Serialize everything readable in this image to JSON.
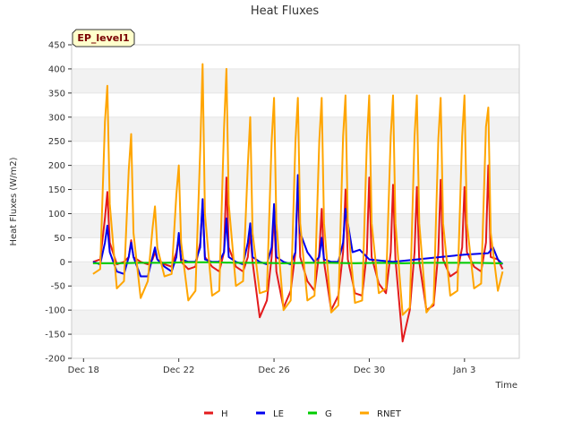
{
  "chart_data": {
    "type": "line",
    "title": "Heat Fluxes",
    "badge": "EP_level1",
    "xlabel": "Time",
    "ylabel": "Heat Fluxes (W/m2)",
    "xlim": [
      17.5,
      36.3
    ],
    "ylim": [
      -200,
      450
    ],
    "grid": true,
    "legend_position": "bottom",
    "x_ticks": [
      {
        "x": 18,
        "label": "Dec 18"
      },
      {
        "x": 22,
        "label": "Dec 22"
      },
      {
        "x": 26,
        "label": "Dec 26"
      },
      {
        "x": 30,
        "label": "Dec 30"
      },
      {
        "x": 34,
        "label": "Jan 3"
      }
    ],
    "y_ticks": [
      -200,
      -150,
      -100,
      -50,
      0,
      50,
      100,
      150,
      200,
      250,
      300,
      350,
      400,
      450
    ],
    "series": [
      {
        "name": "H",
        "color": "#e31a1c",
        "x": [
          18.4,
          18.7,
          18.9,
          19.0,
          19.1,
          19.4,
          19.7,
          19.9,
          20.0,
          20.1,
          20.4,
          20.7,
          20.9,
          21.0,
          21.1,
          21.4,
          21.7,
          21.9,
          22.0,
          22.1,
          22.4,
          22.7,
          22.9,
          23.0,
          23.1,
          23.4,
          23.7,
          23.9,
          24.0,
          24.1,
          24.4,
          24.7,
          24.9,
          25.0,
          25.1,
          25.4,
          25.7,
          25.9,
          26.0,
          26.1,
          26.4,
          26.7,
          26.9,
          27.0,
          27.1,
          27.4,
          27.7,
          27.9,
          28.0,
          28.1,
          28.4,
          28.7,
          28.9,
          29.0,
          29.1,
          29.4,
          29.7,
          29.9,
          30.0,
          30.1,
          30.4,
          30.7,
          30.9,
          31.0,
          31.1,
          31.4,
          31.7,
          31.9,
          32.0,
          32.1,
          32.4,
          32.7,
          32.9,
          33.0,
          33.1,
          33.4,
          33.7,
          33.9,
          34.0,
          34.1,
          34.4,
          34.7,
          34.9,
          35.0,
          35.1,
          35.4,
          35.6
        ],
        "y": [
          0,
          5,
          90,
          145,
          40,
          -5,
          0,
          10,
          45,
          10,
          0,
          -5,
          5,
          20,
          5,
          -5,
          -10,
          20,
          50,
          0,
          -15,
          -10,
          40,
          120,
          10,
          -10,
          -20,
          20,
          175,
          30,
          -10,
          -20,
          10,
          60,
          0,
          -115,
          -80,
          10,
          100,
          -20,
          -95,
          -60,
          20,
          165,
          10,
          -40,
          -60,
          20,
          110,
          0,
          -100,
          -70,
          20,
          150,
          5,
          -65,
          -70,
          20,
          175,
          10,
          -45,
          -65,
          20,
          160,
          5,
          -165,
          -100,
          20,
          155,
          0,
          -100,
          -90,
          20,
          170,
          5,
          -30,
          -20,
          30,
          155,
          20,
          -10,
          -20,
          40,
          200,
          10,
          5,
          -15
        ]
      },
      {
        "name": "LE",
        "color": "#0000ee",
        "x": [
          18.4,
          18.7,
          18.9,
          19.0,
          19.1,
          19.4,
          19.7,
          19.9,
          20.0,
          20.1,
          20.4,
          20.7,
          20.9,
          21.0,
          21.1,
          21.4,
          21.7,
          21.9,
          22.0,
          22.1,
          22.4,
          22.7,
          22.9,
          23.0,
          23.1,
          23.4,
          23.7,
          23.9,
          24.0,
          24.1,
          24.4,
          24.7,
          24.9,
          25.0,
          25.1,
          25.4,
          25.7,
          25.9,
          26.0,
          26.1,
          26.4,
          26.7,
          26.9,
          27.0,
          27.1,
          27.4,
          27.7,
          27.9,
          28.0,
          28.1,
          28.4,
          28.7,
          28.9,
          29.0,
          29.3,
          29.6,
          30.0,
          31.0,
          32.0,
          33.0,
          34.0,
          35.0,
          35.2,
          35.4,
          35.6
        ],
        "y": [
          0,
          -5,
          40,
          75,
          20,
          -20,
          -25,
          10,
          40,
          10,
          -30,
          -30,
          10,
          30,
          5,
          -10,
          -20,
          10,
          60,
          5,
          0,
          0,
          30,
          130,
          5,
          0,
          0,
          20,
          90,
          10,
          0,
          -5,
          40,
          80,
          10,
          0,
          -5,
          30,
          120,
          10,
          0,
          -5,
          20,
          180,
          60,
          20,
          0,
          10,
          50,
          5,
          0,
          0,
          40,
          110,
          20,
          25,
          5,
          0,
          5,
          10,
          15,
          18,
          30,
          5,
          -5
        ]
      },
      {
        "name": "G",
        "color": "#00cc00",
        "x": [
          18.4,
          19.4,
          20.4,
          21.4,
          22.4,
          23.4,
          24.4,
          25.4,
          26.4,
          27.4,
          28.4,
          29.4,
          30.4,
          31.4,
          32.4,
          33.4,
          34.4,
          35.4,
          35.6
        ],
        "y": [
          -3,
          -3,
          -2,
          -2,
          -1,
          -1,
          -2,
          -2,
          -3,
          -2,
          -2,
          -3,
          -2,
          -3,
          -2,
          -2,
          -2,
          -3,
          -3
        ]
      },
      {
        "name": "RNET",
        "color": "#ffa500",
        "x": [
          18.4,
          18.7,
          18.9,
          19.0,
          19.1,
          19.4,
          19.7,
          19.9,
          20.0,
          20.1,
          20.4,
          20.7,
          20.9,
          21.0,
          21.1,
          21.4,
          21.7,
          21.9,
          22.0,
          22.1,
          22.4,
          22.7,
          22.9,
          23.0,
          23.1,
          23.4,
          23.7,
          23.9,
          24.0,
          24.1,
          24.4,
          24.7,
          24.9,
          25.0,
          25.1,
          25.4,
          25.7,
          25.9,
          26.0,
          26.1,
          26.4,
          26.7,
          26.9,
          27.0,
          27.1,
          27.4,
          27.7,
          27.9,
          28.0,
          28.1,
          28.4,
          28.7,
          28.9,
          29.0,
          29.1,
          29.4,
          29.7,
          29.9,
          30.0,
          30.1,
          30.4,
          30.7,
          30.9,
          31.0,
          31.1,
          31.4,
          31.7,
          31.9,
          32.0,
          32.1,
          32.4,
          32.7,
          32.9,
          33.0,
          33.1,
          33.4,
          33.7,
          33.9,
          34.0,
          34.1,
          34.4,
          34.7,
          34.9,
          35.0,
          35.1,
          35.4,
          35.6
        ],
        "y": [
          -25,
          -15,
          290,
          365,
          120,
          -55,
          -40,
          190,
          265,
          60,
          -75,
          -40,
          70,
          115,
          30,
          -30,
          -25,
          140,
          200,
          40,
          -80,
          -60,
          230,
          410,
          100,
          -70,
          -60,
          275,
          400,
          120,
          -50,
          -40,
          200,
          300,
          60,
          -65,
          -60,
          250,
          340,
          80,
          -100,
          -80,
          250,
          340,
          80,
          -80,
          -70,
          250,
          340,
          80,
          -105,
          -90,
          260,
          345,
          80,
          -85,
          -80,
          250,
          345,
          80,
          -65,
          -55,
          260,
          345,
          80,
          -110,
          -95,
          260,
          345,
          80,
          -105,
          -85,
          255,
          340,
          80,
          -70,
          -60,
          260,
          345,
          80,
          -55,
          -45,
          280,
          320,
          60,
          -60,
          -20
        ]
      }
    ]
  }
}
